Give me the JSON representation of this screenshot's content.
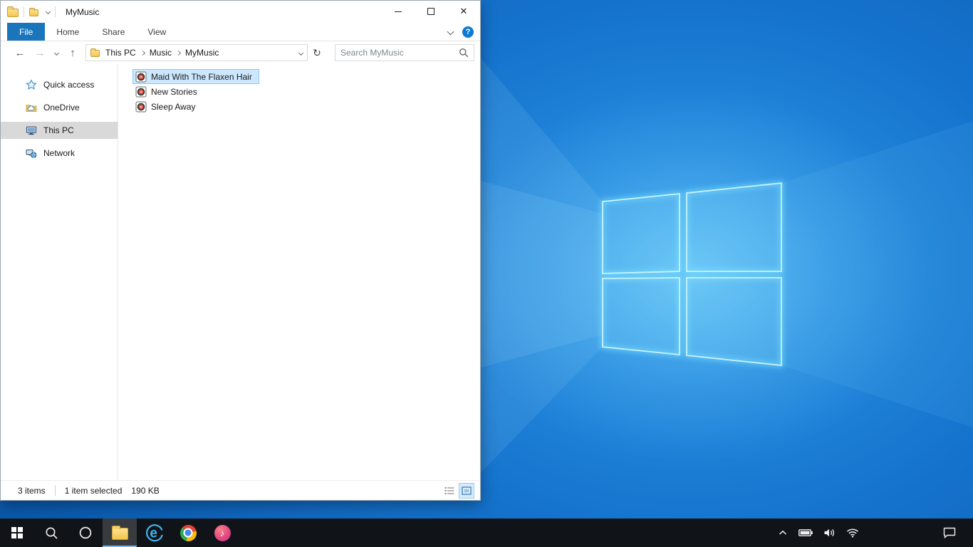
{
  "colors": {
    "accent_blue": "#1b75bb",
    "selection_fill": "#cce8ff",
    "selection_border": "#8fc6f2",
    "sidebar_selected": "#d9d9d9",
    "taskbar_bg": "#101418",
    "wallpaper_light": "#2f9bea",
    "wallpaper_dark": "#0a58ab",
    "folder_yellow": "#f6c44c"
  },
  "titlebar": {
    "title": "MyMusic"
  },
  "ribbon": {
    "file_tab": "File",
    "tabs": [
      {
        "label": "Home"
      },
      {
        "label": "Share"
      },
      {
        "label": "View"
      }
    ],
    "help": "?"
  },
  "address": {
    "crumbs": [
      {
        "label": "This PC"
      },
      {
        "label": "Music"
      },
      {
        "label": "MyMusic"
      }
    ],
    "search_placeholder": "Search MyMusic"
  },
  "icons": {
    "back": "←",
    "forward": "→",
    "up": "↑",
    "refresh": "↻",
    "close": "✕",
    "note": "♪",
    "ie_letter": "e"
  },
  "sidebar": {
    "items": [
      {
        "label": "Quick access",
        "icon": "quick-access-star"
      },
      {
        "label": "OneDrive",
        "icon": "onedrive-folder"
      },
      {
        "label": "This PC",
        "icon": "this-pc-monitor",
        "selected": true
      },
      {
        "label": "Network",
        "icon": "network-globe"
      }
    ]
  },
  "files": [
    {
      "name": "Maid With The Flaxen Hair",
      "selected": true
    },
    {
      "name": "New Stories",
      "selected": false
    },
    {
      "name": "Sleep Away",
      "selected": false
    }
  ],
  "statusbar": {
    "count": "3 items",
    "selected": "1 item selected",
    "size": "190 KB"
  },
  "taskbar": {
    "buttons": [
      {
        "name": "start"
      },
      {
        "name": "search"
      },
      {
        "name": "cortana"
      },
      {
        "name": "file-explorer",
        "active": true
      },
      {
        "name": "internet-explorer"
      },
      {
        "name": "chrome"
      },
      {
        "name": "itunes"
      }
    ],
    "tray": [
      "hidden-icons-chevron",
      "battery",
      "volume",
      "network",
      "action-center"
    ]
  }
}
